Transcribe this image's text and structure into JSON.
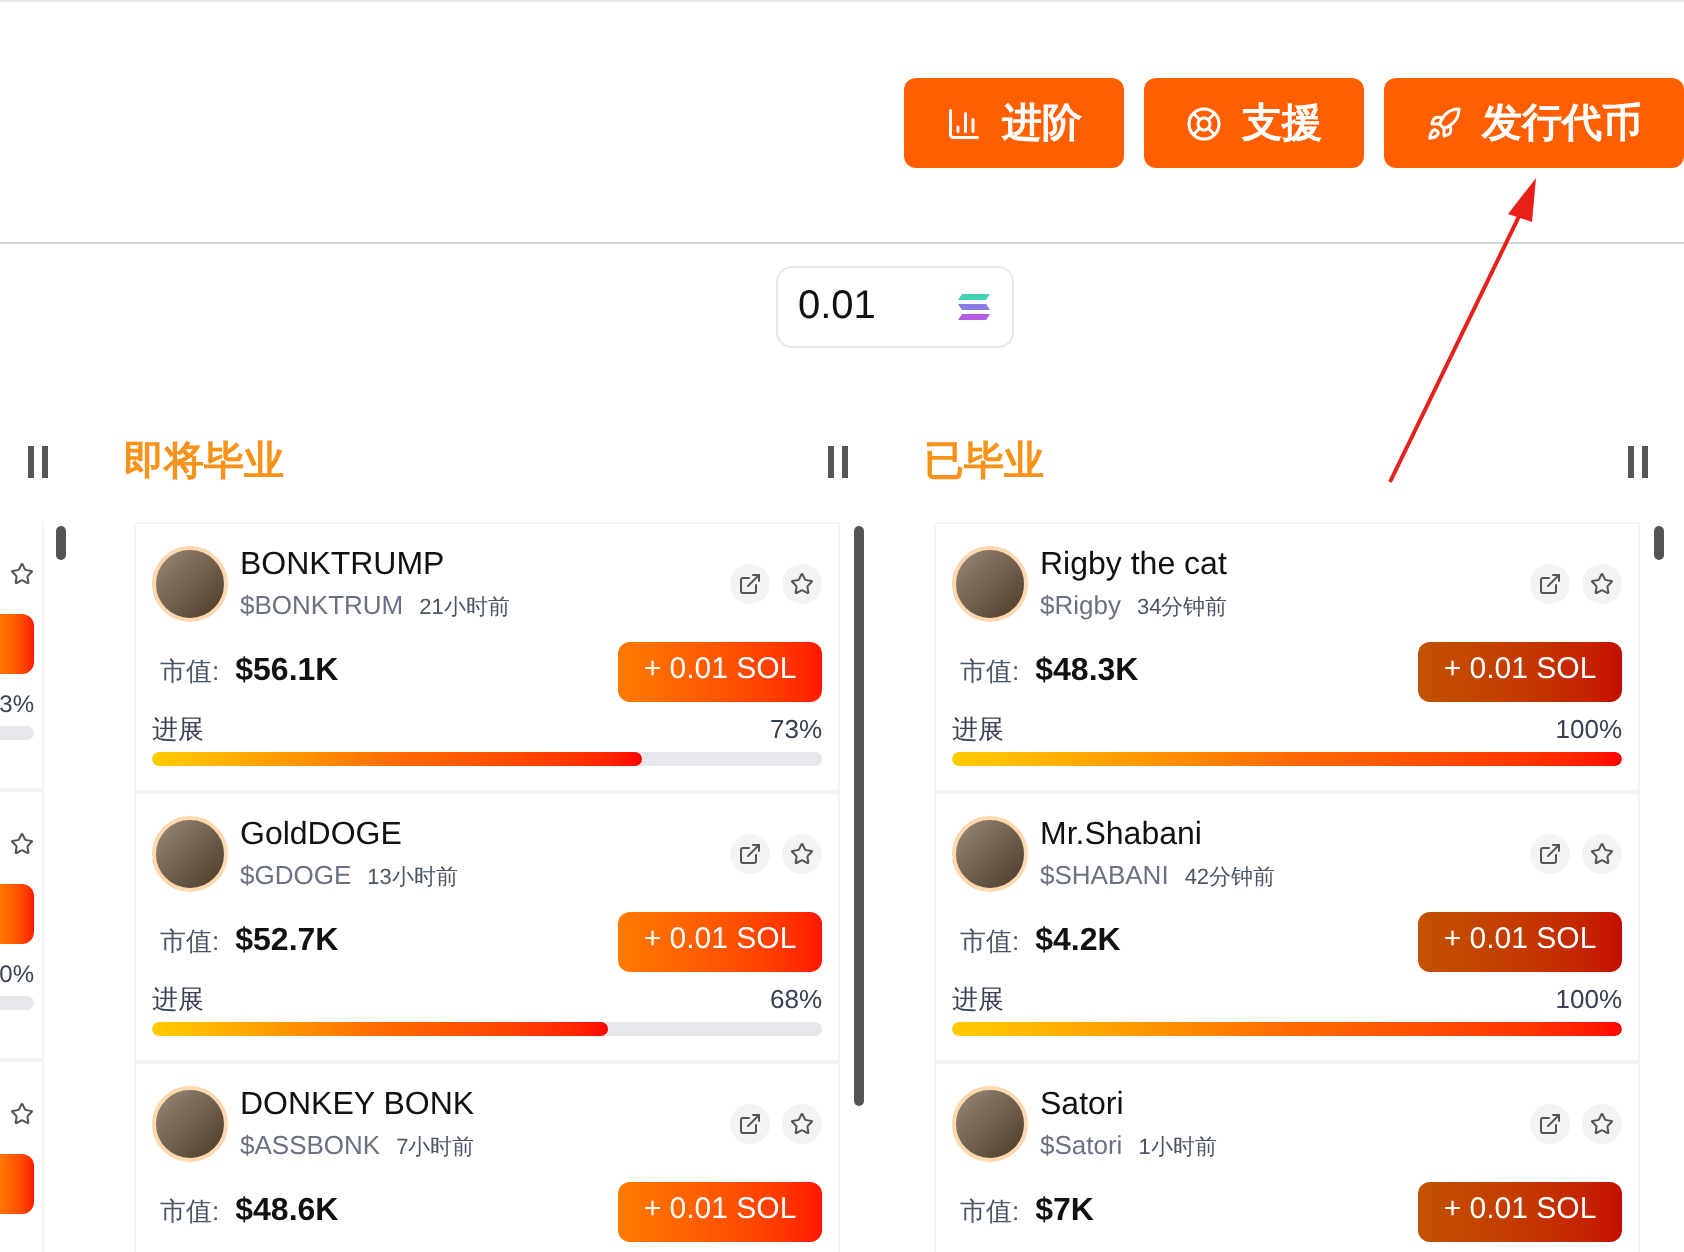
{
  "header": {
    "buttons": [
      {
        "label": "进阶"
      },
      {
        "label": "支援"
      },
      {
        "label": "发行代币"
      }
    ]
  },
  "amount_field": {
    "value": "0.01"
  },
  "partial_column": {
    "percents": [
      "3%",
      "0%"
    ]
  },
  "columns": [
    {
      "title": "即将毕业",
      "kind": "active",
      "cards": [
        {
          "name": "BONKTRUMP",
          "ticker": "$BONKTRUM",
          "time": "21小时前",
          "mcap_label": "市值:",
          "mcap": "$56.1K",
          "button": "+ 0.01 SOL",
          "progress_label": "进展",
          "progress_text": "73%",
          "level": 0.73
        },
        {
          "name": "GoldDOGE",
          "ticker": "$GDOGE",
          "time": "13小时前",
          "mcap_label": "市值:",
          "mcap": "$52.7K",
          "button": "+ 0.01 SOL",
          "progress_label": "进展",
          "progress_text": "68%",
          "level": 0.68
        },
        {
          "name": "DONKEY BONK",
          "ticker": "$ASSBONK",
          "time": "7小时前",
          "mcap_label": "市值:",
          "mcap": "$48.6K",
          "button": "+ 0.01 SOL"
        }
      ]
    },
    {
      "title": "已毕业",
      "kind": "graduated",
      "cards": [
        {
          "name": "Rigby the cat",
          "ticker": "$Rigby",
          "time": "34分钟前",
          "mcap_label": "市值:",
          "mcap": "$48.3K",
          "button": "+ 0.01 SOL",
          "progress_label": "进展",
          "progress_text": "100%",
          "level": 1
        },
        {
          "name": "Mr.Shabani",
          "ticker": "$SHABANI",
          "time": "42分钟前",
          "mcap_label": "市值:",
          "mcap": "$4.2K",
          "button": "+ 0.01 SOL",
          "progress_label": "进展",
          "progress_text": "100%",
          "level": 1
        },
        {
          "name": "Satori",
          "ticker": "$Satori",
          "time": "1小时前",
          "mcap_label": "市值:",
          "mcap": "$7K",
          "button": "+ 0.01 SOL"
        }
      ]
    }
  ]
}
